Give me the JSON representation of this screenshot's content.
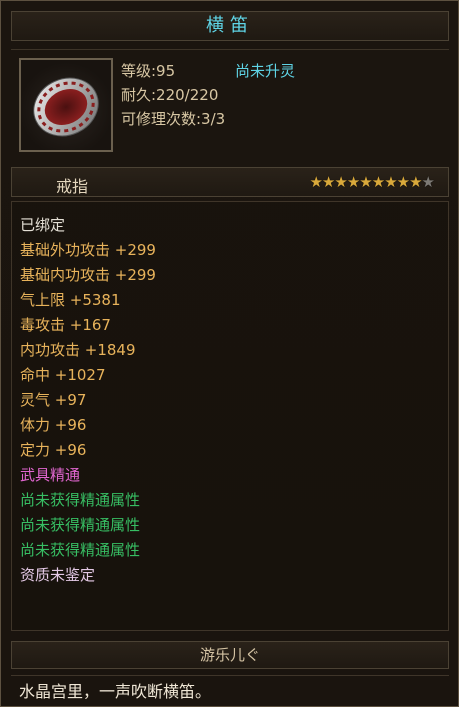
{
  "item": {
    "name": "横笛",
    "type": "戒指",
    "level_line": "等级:95",
    "spirit_state": "尚未升灵",
    "durability_line": "耐久:220/220",
    "repair_line": "可修理次数:3/3",
    "stars_filled": 9,
    "stars_total": 10
  },
  "attributes": [
    "已绑定",
    "基础外功攻击 +299",
    "基础内功攻击 +299",
    "气上限 +5381",
    "毒攻击 +167",
    "内功攻击 +1849",
    "命中 +1027",
    "灵气 +97",
    "体力 +96",
    "定力 +96",
    "武具精通",
    "尚未获得精通属性",
    "尚未获得精通属性",
    "尚未获得精通属性",
    "资质未鉴定"
  ],
  "colors": {
    "title": "#5fd4e6",
    "bound": "#e5e0d6",
    "gold_stat": "#e8b35b",
    "mastery": "#e066cf",
    "mastery_empty": "#37be63",
    "appraise": "#e4c9e6",
    "star": "#d9a93b"
  },
  "flavor_section": {
    "title": "游乐儿ぐ",
    "text": "水晶宫里，一声吹断横笛。"
  }
}
